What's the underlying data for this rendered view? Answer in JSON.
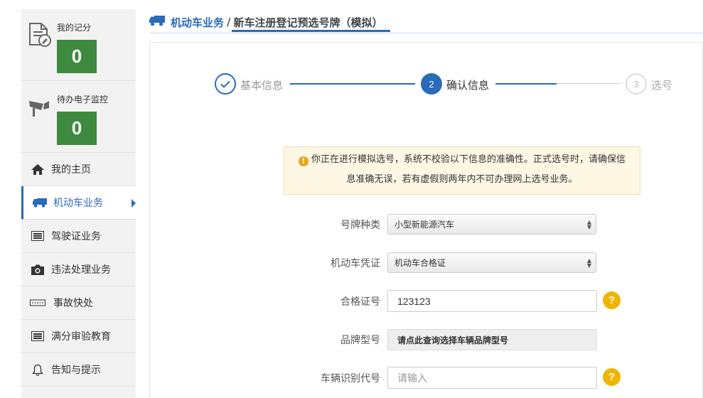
{
  "sidebar": {
    "score": {
      "title": "我的记分",
      "count": "0",
      "icon": "document-pen-icon"
    },
    "monitor": {
      "title": "待办电子监控",
      "count": "0",
      "icon": "camera-cctv-icon"
    },
    "items": [
      {
        "label": "我的主页",
        "icon": "home-icon"
      },
      {
        "label": "机动车业务",
        "icon": "truck-icon",
        "active": true
      },
      {
        "label": "驾驶证业务",
        "icon": "card-list-icon"
      },
      {
        "label": "违法处理业务",
        "icon": "camera-icon"
      },
      {
        "label": "事故快处",
        "icon": "accident-icon"
      },
      {
        "label": "满分审验教育",
        "icon": "card-list-icon"
      },
      {
        "label": "告知与提示",
        "icon": "bell-icon"
      }
    ]
  },
  "breadcrumb": {
    "section": "机动车业务",
    "separator": "/",
    "page": "新车注册登记预选号牌（模拟）"
  },
  "steps": [
    {
      "number": "",
      "label": "基本信息",
      "state": "done"
    },
    {
      "number": "2",
      "label": "确认信息",
      "state": "current"
    },
    {
      "number": "3",
      "label": "选号",
      "state": "pending"
    }
  ],
  "notice": {
    "line1": "你正在进行模拟选号，系统不校验以下信息的准确性。正式选号时，请确保信",
    "line2": "息准确无误，若有虚假则两年内不可办理网上选号业务。"
  },
  "form": {
    "plate_type": {
      "label": "号牌种类",
      "value": "小型新能源汽车"
    },
    "certificate": {
      "label": "机动车凭证",
      "value": "机动车合格证"
    },
    "cert_no": {
      "label": "合格证号",
      "value": "123123",
      "help": "?"
    },
    "brand": {
      "label": "品牌型号",
      "value": "请点此查询选择车辆品牌型号"
    },
    "vin": {
      "label": "车辆识别代号",
      "placeholder": "请输入",
      "help": "?"
    }
  },
  "colors": {
    "accent": "#2a6ab8",
    "score_green": "#3e8a3e",
    "help_yellow": "#f0b400",
    "notice_bg": "#fdf7e4"
  }
}
